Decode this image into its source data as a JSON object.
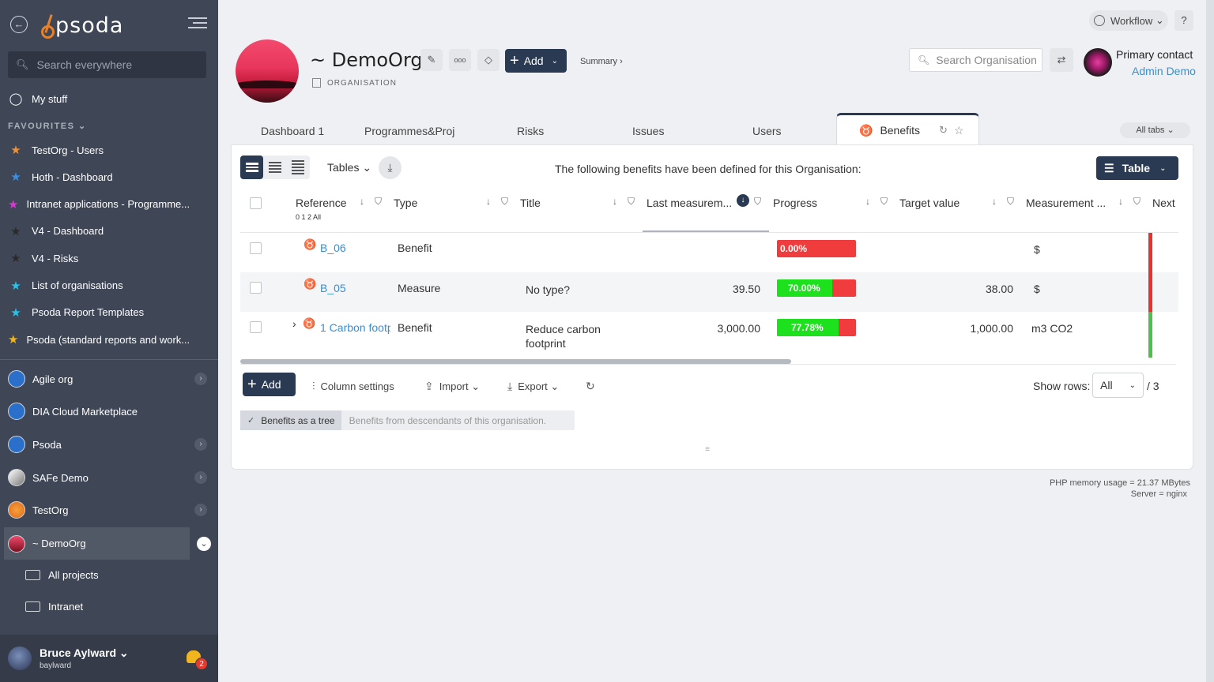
{
  "sidebar": {
    "logo": "psoda",
    "search_placeholder": "Search everywhere",
    "my_stuff": "My stuff",
    "favourites_label": "FAVOURITES",
    "favourites": [
      {
        "label": "TestOrg - Users",
        "color": "#f0913c"
      },
      {
        "label": "Hoth - Dashboard",
        "color": "#3b8fe0"
      },
      {
        "label": "Intranet applications - Programme...",
        "color": "#d63ad0"
      },
      {
        "label": "V4 - Dashboard",
        "color": "#2a2a2a"
      },
      {
        "label": "V4 - Risks",
        "color": "#2a2a2a"
      },
      {
        "label": "List of organisations",
        "color": "#2cc2e8"
      },
      {
        "label": "Psoda Report Templates",
        "color": "#2cc2e8"
      },
      {
        "label": "Psoda (standard reports and work...",
        "color": "#f2b61f"
      }
    ],
    "orgs": [
      {
        "label": "Agile org",
        "has_chevron": true
      },
      {
        "label": "DIA Cloud Marketplace",
        "has_chevron": false
      },
      {
        "label": "Psoda",
        "has_chevron": true
      },
      {
        "label": "SAFe Demo",
        "has_chevron": true
      },
      {
        "label": "TestOrg",
        "has_chevron": true
      },
      {
        "label": "~ DemoOrg",
        "has_chevron": true
      }
    ],
    "sub_items": [
      "All projects",
      "Intranet"
    ],
    "user": {
      "name": "Bruce Aylward",
      "username": "baylward",
      "notifications": "2"
    }
  },
  "header": {
    "title": "~ DemoOrg",
    "subtitle": "ORGANISATION",
    "add_label": "Add",
    "summary_label": "Summary ›",
    "workflow_label": "Workflow",
    "help_label": "?",
    "search_placeholder": "Search Organisation",
    "primary_contact_label": "Primary contact",
    "primary_contact_name": "Admin Demo"
  },
  "tabs": {
    "items": [
      "Dashboard 1",
      "Programmes&Proj",
      "Risks",
      "Issues",
      "Users"
    ],
    "active": "Benefits",
    "all_tabs_label": "All tabs"
  },
  "panel": {
    "tables_label": "Tables",
    "intro": "The following benefits have been defined for this Organisation:",
    "view_label": "Table",
    "columns": [
      "Reference",
      "Type",
      "Title",
      "Last measurem...",
      "Progress",
      "Target value",
      "Measurement ...",
      "Next"
    ],
    "levels": "0 1 2 All",
    "rows": [
      {
        "reference": "B_06",
        "type": "Benefit",
        "title": "",
        "title2": "",
        "last": "",
        "progress": 0.0,
        "progress_label": "0.00%",
        "target": "",
        "unit": "$",
        "rag": "#e8322e",
        "expand": ""
      },
      {
        "reference": "B_05",
        "type": "Measure",
        "title": "No type?",
        "title2": "",
        "last": "39.50",
        "progress": 0.7,
        "progress_label": "70.00%",
        "target": "38.00",
        "unit": "$",
        "rag": "#e8322e",
        "expand": ""
      },
      {
        "reference": "1 Carbon footp",
        "type": "Benefit",
        "title": "Reduce carbon",
        "title2": "footprint",
        "last": "3,000.00",
        "progress": 0.7778,
        "progress_label": "77.78%",
        "target": "1,000.00",
        "unit": "m3 CO2",
        "rag": "#4cbf4c",
        "expand": "›"
      }
    ],
    "add_label": "Add",
    "column_settings_label": "Column settings",
    "import_label": "Import",
    "export_label": "Export",
    "show_rows_label": "Show rows:",
    "show_rows_value": "All",
    "rows_total": "/ 3",
    "tree_on_label": "Benefits as a tree",
    "tree_off_label": "Benefits from descendants of this organisation."
  },
  "footer": {
    "memory": "PHP memory usage = 21.37 MBytes",
    "server": "Server = nginx"
  }
}
